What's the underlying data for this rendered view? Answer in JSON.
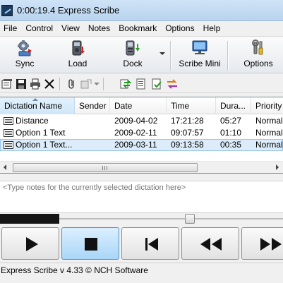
{
  "window": {
    "title": "0:00:19.4 Express Scribe"
  },
  "menu": [
    "File",
    "Control",
    "View",
    "Notes",
    "Bookmark",
    "Options",
    "Help"
  ],
  "toolbar": {
    "sync": "Sync",
    "load": "Load",
    "dock": "Dock",
    "scribe_mini": "Scribe Mini",
    "options": "Options"
  },
  "list": {
    "columns": [
      "Dictation Name",
      "Sender",
      "Date",
      "Time",
      "Dura...",
      "Priority"
    ],
    "rows": [
      {
        "name": "Distance",
        "sender": "",
        "date": "2009-04-02",
        "time": "17:21:28",
        "duration": "05:27",
        "priority": "Normal"
      },
      {
        "name": "Option 1 Text",
        "sender": "",
        "date": "2009-02-11",
        "time": "09:07:57",
        "duration": "01:10",
        "priority": "Normal"
      },
      {
        "name": "Option 1 Text...",
        "sender": "",
        "date": "2009-03-11",
        "time": "09:13:58",
        "duration": "00:35",
        "priority": "Normal"
      }
    ],
    "selected_row": 2
  },
  "notes": {
    "placeholder": "<Type notes for the currently selected dictation here>"
  },
  "playback": {
    "played_fraction": 0.21
  },
  "status": "Express Scribe v 4.33 © NCH Software",
  "colors": {
    "title_bar": "#c4dbf3",
    "selection": "#ddecfa",
    "active_button": "#a9d6f7"
  }
}
